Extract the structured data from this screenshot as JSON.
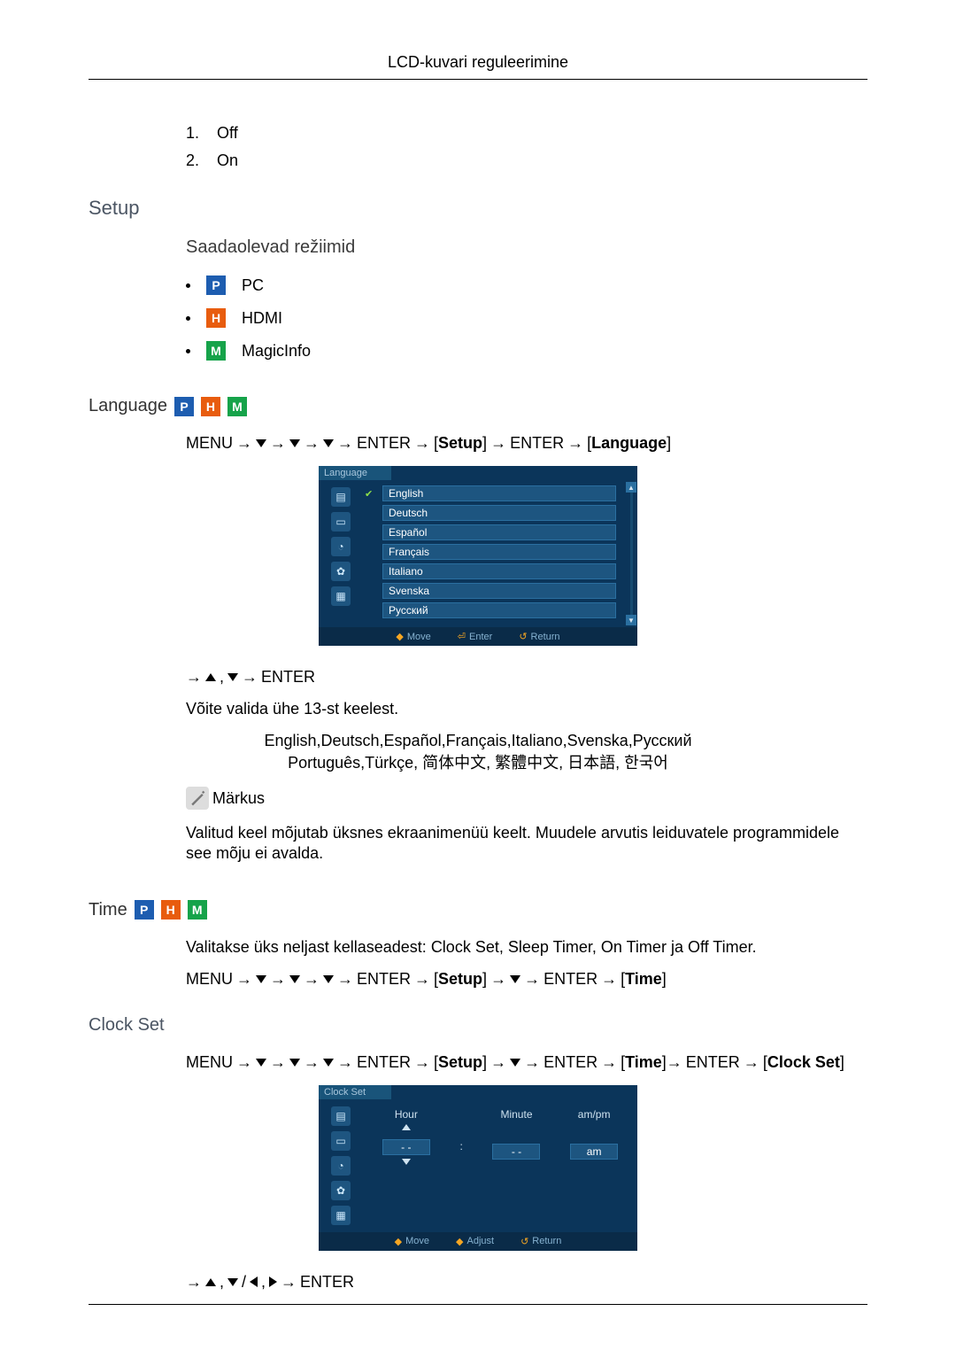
{
  "header": {
    "title": "LCD-kuvari reguleerimine"
  },
  "top_list": [
    {
      "n": "1.",
      "label": "Off"
    },
    {
      "n": "2.",
      "label": "On"
    }
  ],
  "setup_heading": "Setup",
  "modes_heading": "Saadaolevad režiimid",
  "modes": [
    {
      "iconLetter": "P",
      "iconClass": "p",
      "iconName": "mode-pc-icon",
      "label": "PC"
    },
    {
      "iconLetter": "H",
      "iconClass": "h",
      "iconName": "mode-hdmi-icon",
      "label": "HDMI"
    },
    {
      "iconLetter": "M",
      "iconClass": "m",
      "iconName": "mode-magicinfo-icon",
      "label": "MagicInfo"
    }
  ],
  "language": {
    "heading": "Language",
    "nav": {
      "menu": "MENU",
      "enter1": "ENTER",
      "setup": "Setup",
      "enter2": "ENTER",
      "language": "Language"
    },
    "osd_title": "Language",
    "languages": [
      "English",
      "Deutsch",
      "Español",
      "Français",
      "Italiano",
      "Svenska",
      "Русский"
    ],
    "selected_index": 0,
    "footer": {
      "move": "Move",
      "enter": "Enter",
      "return": "Return"
    },
    "nav2_enter": "ENTER",
    "choose_text": "Võite valida ühe 13-st keelest.",
    "all_langs_line1": "English,Deutsch,Español,Français,Italiano,Svenska,Русский",
    "all_langs_line2": "Português,Türkçe, 简体中文,  繁體中文, 日本語, 한국어",
    "note_label": "Märkus",
    "note_text": "Valitud keel mõjutab üksnes ekraanimenüü keelt. Muudele arvutis leiduvatele programmidele see mõju ei avalda."
  },
  "time": {
    "heading": "Time",
    "intro": {
      "prefix": "Valitakse üks neljast kellaseadest: ",
      "parts": [
        "Clock Set",
        "Sleep Timer",
        "On Timer",
        "Off Timer"
      ],
      "joiners": [
        ", ",
        ", ",
        " ja ",
        "."
      ]
    },
    "nav": {
      "menu": "MENU",
      "enter1": "ENTER",
      "setup": "Setup",
      "enter2": "ENTER",
      "time": "Time"
    }
  },
  "clockset": {
    "heading": "Clock Set",
    "nav": {
      "menu": "MENU",
      "enter1": "ENTER",
      "setup": "Setup",
      "enter2": "ENTER",
      "time": "Time",
      "enter3": "ENTER",
      "clockset": "Clock Set"
    },
    "osd_title": "Clock Set",
    "cols": {
      "hour": {
        "label": "Hour",
        "value": "- -"
      },
      "minute": {
        "label": "Minute",
        "value": "- -"
      },
      "ampm": {
        "label": "am/pm",
        "value": "am"
      }
    },
    "footer": {
      "move": "Move",
      "adjust": "Adjust",
      "return": "Return"
    },
    "nav2_enter": "ENTER",
    "colon": ":"
  }
}
